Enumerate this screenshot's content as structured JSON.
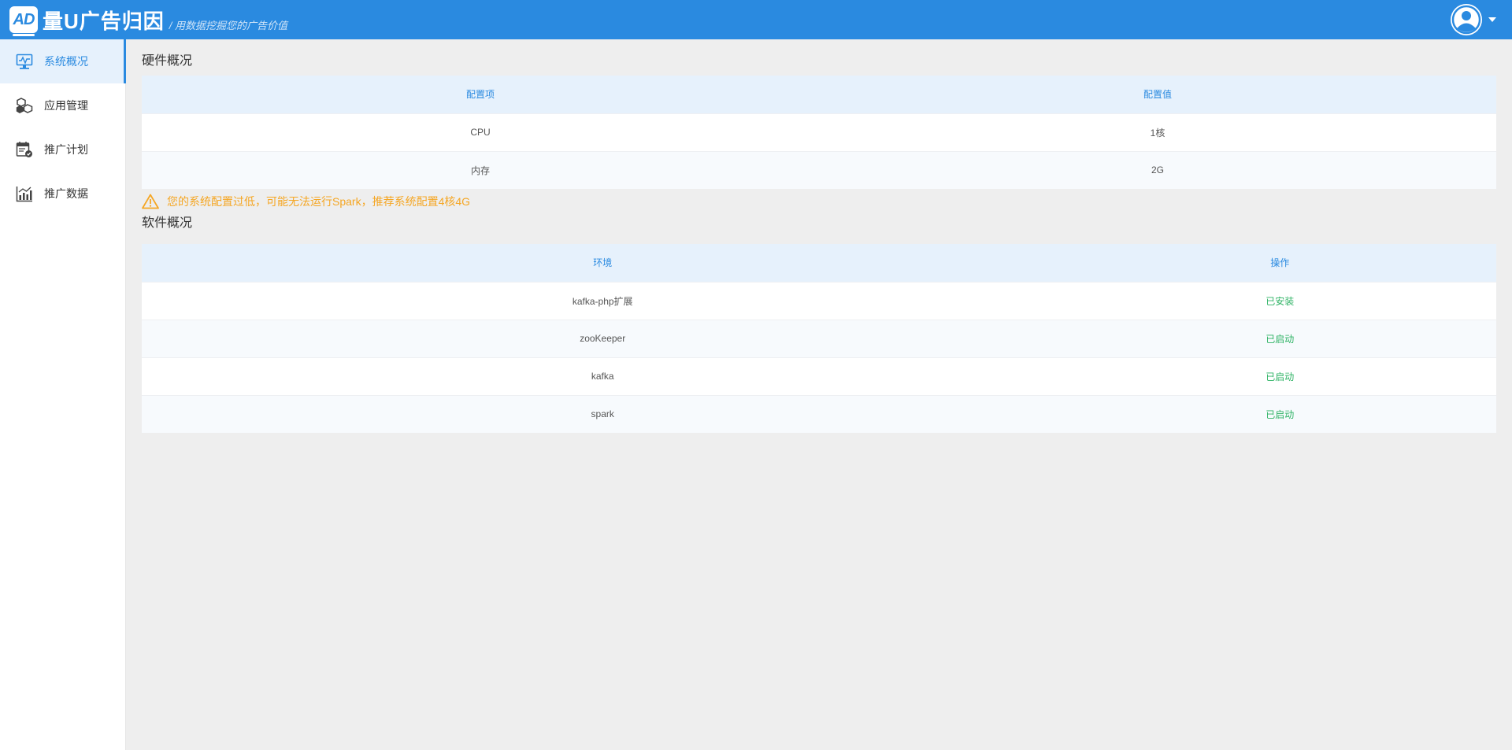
{
  "header": {
    "logo_badge": "AD",
    "logo_name": "量U广告归因",
    "slogan": "/ 用数据挖掘您的广告价值",
    "colors": {
      "primary": "#2a8ae0",
      "warning": "#f5a623",
      "success": "#2fb365"
    }
  },
  "sidebar": {
    "items": [
      {
        "label": "系统概况",
        "icon": "monitor-icon",
        "active": true
      },
      {
        "label": "应用管理",
        "icon": "cubes-icon",
        "active": false
      },
      {
        "label": "推广计划",
        "icon": "calendar-check-icon",
        "active": false
      },
      {
        "label": "推广数据",
        "icon": "bar-chart-icon",
        "active": false
      }
    ]
  },
  "hardware": {
    "title": "硬件概况",
    "columns": [
      "配置项",
      "配置值"
    ],
    "rows": [
      [
        "CPU",
        "1核"
      ],
      [
        "内存",
        "2G"
      ]
    ],
    "warning": "您的系统配置过低，可能无法运行Spark，推荐系统配置4核4G"
  },
  "software": {
    "title": "软件概况",
    "columns": [
      "环境",
      "操作"
    ],
    "rows": [
      [
        "kafka-php扩展",
        "已安装"
      ],
      [
        "zooKeeper",
        "已启动"
      ],
      [
        "kafka",
        "已启动"
      ],
      [
        "spark",
        "已启动"
      ]
    ]
  }
}
